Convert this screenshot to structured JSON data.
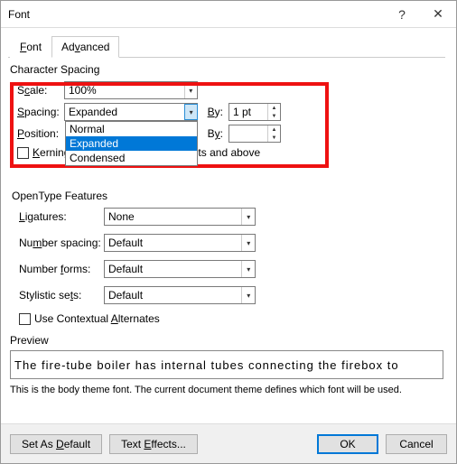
{
  "title": "Font",
  "tabs": {
    "font": "Font",
    "advanced": "Advanced"
  },
  "charspacing": {
    "title": "Character Spacing",
    "scale_label": "Scale:",
    "scale_value": "100%",
    "spacing_label": "Spacing:",
    "spacing_value": "Expanded",
    "spacing_by_label": "By:",
    "spacing_by_value": "1 pt",
    "position_label": "Position:",
    "position_by_label": "By:",
    "position_by_value": "",
    "dropdown": {
      "opt1": "Normal",
      "opt2": "Expanded",
      "opt3": "Condensed"
    },
    "kerning_label": "Kerning for fonts:",
    "kerning_after": "Points and above"
  },
  "opentype": {
    "title": "OpenType Features",
    "ligatures_label": "Ligatures:",
    "ligatures_value": "None",
    "numspacing_label": "Number spacing:",
    "numspacing_value": "Default",
    "numforms_label": "Number forms:",
    "numforms_value": "Default",
    "stylistic_label": "Stylistic sets:",
    "stylistic_value": "Default",
    "contextual_label": "Use Contextual Alternates"
  },
  "preview": {
    "title": "Preview",
    "text": "The fire-tube boiler has internal tubes connecting the firebox to",
    "note": "This is the body theme font. The current document theme defines which font will be used."
  },
  "buttons": {
    "setdefault": "Set As Default",
    "texteffects": "Text Effects...",
    "ok": "OK",
    "cancel": "Cancel"
  }
}
